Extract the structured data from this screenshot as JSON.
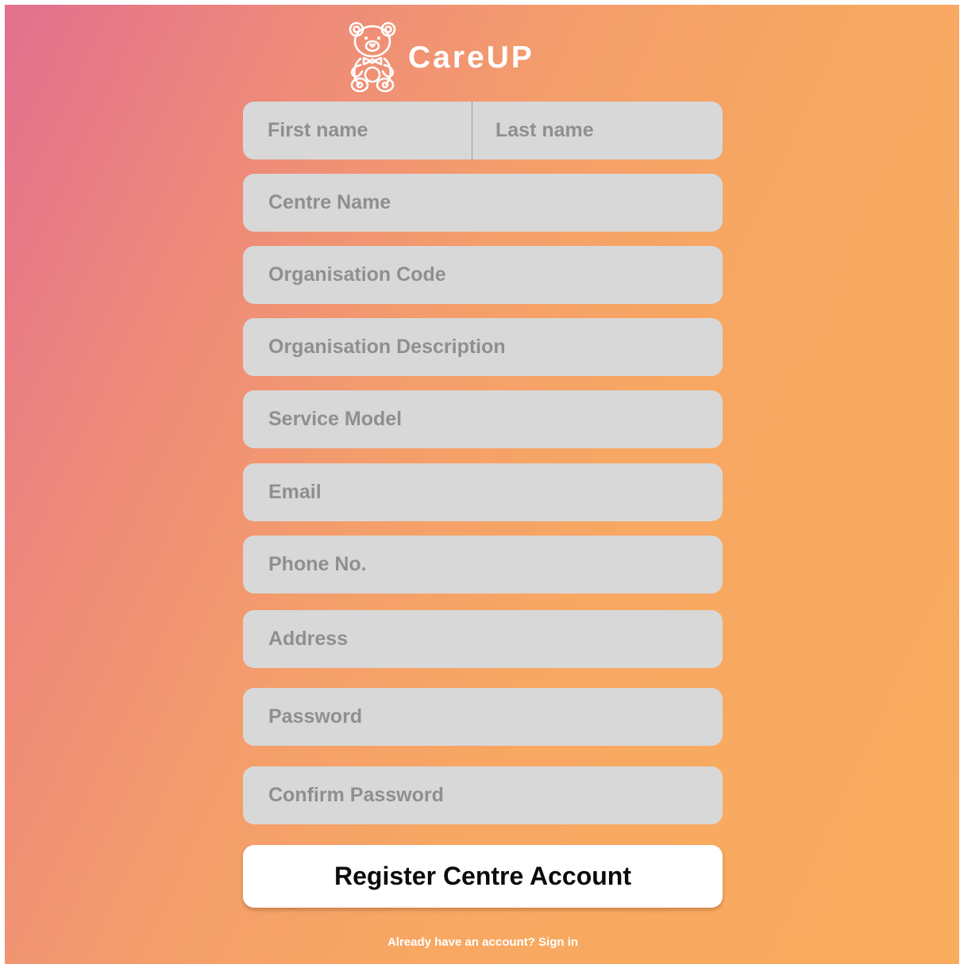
{
  "brand": {
    "name": "CareUP",
    "icon": "teddy-bear-icon"
  },
  "form": {
    "first_name_placeholder": "First name",
    "last_name_placeholder": "Last name",
    "centre_name_placeholder": "Centre Name",
    "organisation_code_placeholder": "Organisation Code",
    "organisation_description_placeholder": "Organisation Description",
    "service_model_placeholder": "Service Model",
    "email_placeholder": "Email",
    "phone_placeholder": "Phone No.",
    "address_placeholder": "Address",
    "password_placeholder": "Password",
    "confirm_password_placeholder": "Confirm Password",
    "submit_label": "Register Centre Account"
  },
  "footer": {
    "prompt": "Already have an account?",
    "signin_label": "Sign in"
  },
  "colors": {
    "gradient_start": "#e2708f",
    "gradient_end": "#f9ac5e",
    "field_background": "#d8d8d8",
    "placeholder_text": "#8f8f8f",
    "button_background": "#ffffff"
  }
}
